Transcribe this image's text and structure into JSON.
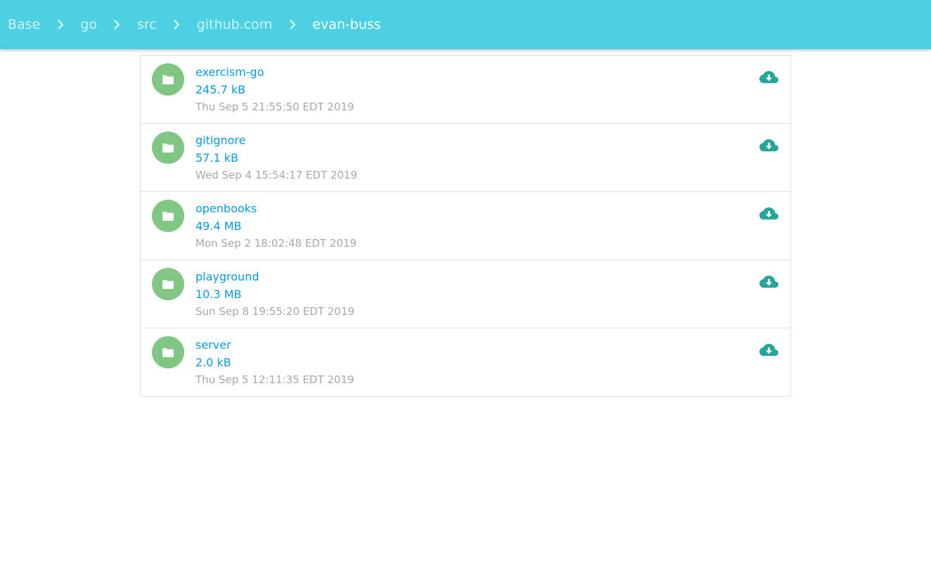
{
  "breadcrumb": [
    {
      "label": "Base"
    },
    {
      "label": "go"
    },
    {
      "label": "src"
    },
    {
      "label": "github.com"
    },
    {
      "label": "evan-buss"
    }
  ],
  "files": [
    {
      "name": "exercism-go",
      "size": "245.7 kB",
      "modified": "Thu Sep 5 21:55:50 EDT 2019",
      "icon": "folder-icon"
    },
    {
      "name": "gitignore",
      "size": "57.1 kB",
      "modified": "Wed Sep 4 15:54:17 EDT 2019",
      "icon": "folder-icon"
    },
    {
      "name": "openbooks",
      "size": "49.4 MB",
      "modified": "Mon Sep 2 18:02:48 EDT 2019",
      "icon": "folder-icon"
    },
    {
      "name": "playground",
      "size": "10.3 MB",
      "modified": "Sun Sep 8 19:55:20 EDT 2019",
      "icon": "folder-icon"
    },
    {
      "name": "server",
      "size": "2.0 kB",
      "modified": "Thu Sep 5 12:11:35 EDT 2019",
      "icon": "folder-icon"
    }
  ],
  "colors": {
    "header": "#4dd0e1",
    "avatar": "#81c784",
    "link": "#039be5",
    "download_icon": "#26a69a",
    "date_text": "#a8a8a8"
  }
}
